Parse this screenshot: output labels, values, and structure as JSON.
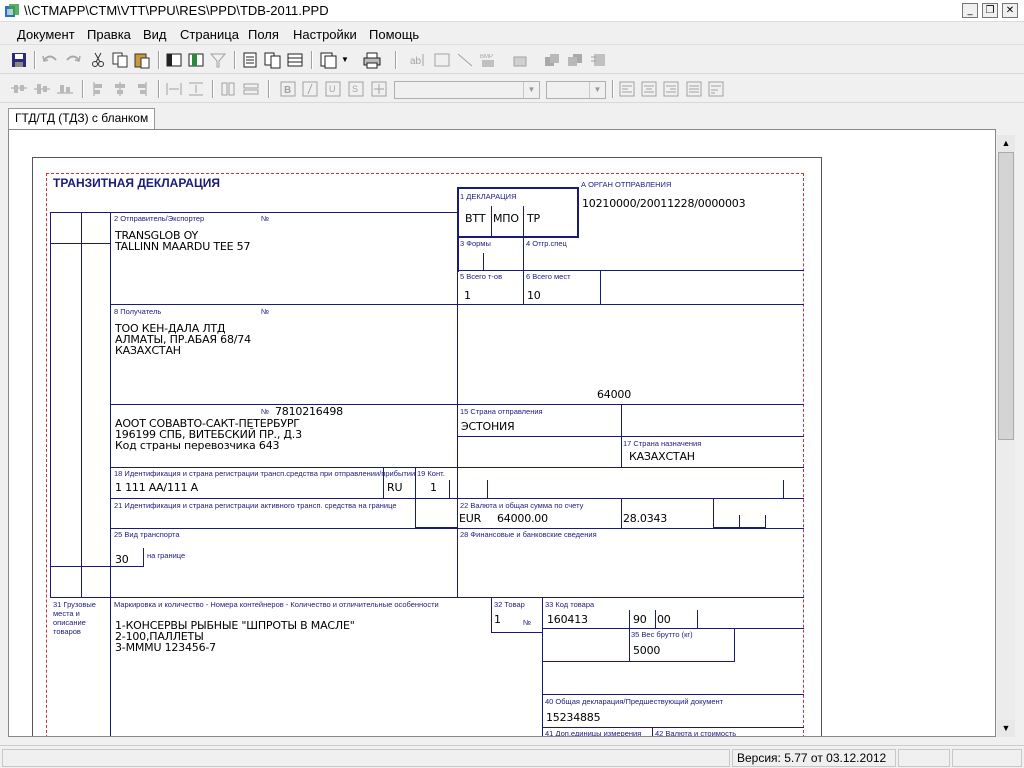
{
  "window": {
    "title": "\\\\CTMAPP\\CTM\\VTT\\PPU\\RES\\PPD\\TDB-2011.PPD"
  },
  "menu": [
    "Документ",
    "Правка",
    "Вид",
    "Страница",
    "Поля",
    "Настройки",
    "Помощь"
  ],
  "tab": {
    "label": "ГТД/ТД (ТДЗ) с бланком"
  },
  "status": {
    "version": "Версия: 5.77 от 03.12.2012"
  },
  "form": {
    "title": "ТРАНЗИТНАЯ ДЕКЛАРАЦИЯ",
    "labels": {
      "decl": "1 ДЕКЛАРАЦИЯ",
      "organ": "А ОРГАН ОТПРАВЛЕНИЯ",
      "sender": "2 Отправитель/Экспортер",
      "no": "№",
      "forms": "3 Формы",
      "otgr": "4 Отгр.спец",
      "items": "5 Всего т-ов",
      "places": "6 Всего мест",
      "receiver": "8 Получатель",
      "depcountry": "15 Страна отправления",
      "destcountry": "17 Страна назначения",
      "ident": "18 Идентификация и страна регистрации трансп.средства при отправлении/прибытии",
      "cont": "19 Конт.",
      "active": "21 Идентификация и страна регистрации активного трансп. средства на границе",
      "currency": "22 Валюта и общая сумма по счету",
      "transport": "25 Вид транспорта",
      "border": "на границе",
      "finance": "28 Финансовые и банковские сведения",
      "cargo": "31 Грузовые\nместа и\nописание\nтоваров",
      "marking": "Маркировка и количество - Номера контейнеров - Количество и отличительные особенности",
      "item32": "32 Товар",
      "code33": "33 Код товара",
      "no2": "№",
      "gross35": "35 Вес брутто (кг)",
      "prev40": "40 Общая декларация/Предшествующий документ",
      "units41": "41 Доп.единицы измерения",
      "cost42": "42 Валюта и стоимость"
    },
    "values": {
      "decl1": "ВТТ",
      "decl2": "МПО",
      "decl3": "ТР",
      "organ": "10210000/20011228/0000003",
      "sender1": "TRANSGLOB OY",
      "sender2": "TALLINN MAARDU TEE 57",
      "items": "1",
      "places": "10",
      "recv1": "ТОО КЕН-ДАЛА ЛТД",
      "recv2": "АЛМАТЫ, ПР.АБАЯ 68/74",
      "recv3": "КАЗАХСТАН",
      "amount64": "64000",
      "carrierNo": "7810216498",
      "carrier1": "АООТ СОВАВТО-САКТ-ПЕТЕРБУРГ",
      "carrier2": "196199 СПБ, ВИТЕБСКИЙ ПР., Д.3",
      "carrier3": "Код страны перевозчика 643",
      "depcountry": "ЭСТОНИЯ",
      "destcountry": "КАЗАХСТАН",
      "vehicle": "1 111 АА/111 А",
      "ru": "RU",
      "cont": "1",
      "cur": "EUR",
      "sum": "64000.00",
      "rate": "28.0343",
      "transport": "30",
      "goods1": "1-КОНСЕРВЫ РЫБНЫЕ \"ШПРОТЫ В МАСЛЕ\"",
      "goods2": "2-100,ПАЛЛЕТЫ",
      "goods3": "3-MMMU 123456-7",
      "item32": "1",
      "code1": "160413",
      "code2": "90",
      "code3": "00",
      "gross": "5000",
      "prev": "15234885"
    }
  }
}
